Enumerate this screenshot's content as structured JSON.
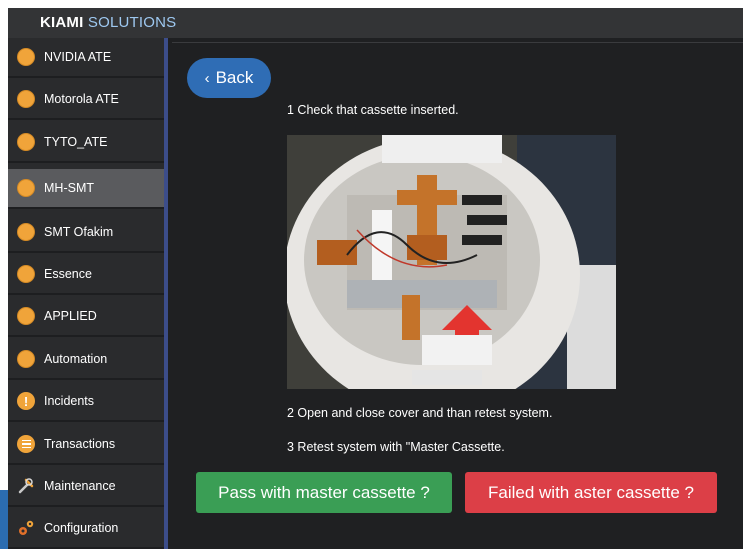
{
  "app": {
    "brand_bold": "KIAMI",
    "brand_light": "SOLUTIONS"
  },
  "sidebar": {
    "items": [
      {
        "label": "NVIDIA ATE",
        "icon": "circle-icon"
      },
      {
        "label": "Motorola ATE",
        "icon": "circle-icon"
      },
      {
        "label": "TYTO_ATE",
        "icon": "circle-icon"
      },
      {
        "label": "MH-SMT",
        "icon": "circle-icon",
        "active": true
      },
      {
        "label": "SMT Ofakim",
        "icon": "circle-icon"
      },
      {
        "label": "Essence",
        "icon": "circle-icon"
      },
      {
        "label": "APPLIED",
        "icon": "circle-icon"
      },
      {
        "label": "Automation",
        "icon": "circle-icon"
      },
      {
        "label": "Incidents",
        "icon": "warning-icon"
      },
      {
        "label": "Transactions",
        "icon": "list-icon"
      },
      {
        "label": "Maintenance",
        "icon": "wrench-icon"
      },
      {
        "label": "Configuration",
        "icon": "gears-icon"
      }
    ]
  },
  "main": {
    "back_label": "Back",
    "step1": "1 Check that cassette inserted.",
    "step2": "2 Open and close cover and than retest system.",
    "step3": "3 Retest system with \"Master Cassette.",
    "pass_button": "Pass with master cassette ?",
    "fail_button": "Failed with aster cassette ?"
  },
  "colors": {
    "accent": "#f0a43a",
    "back_button": "#2f6db5",
    "pass": "#3a9e55",
    "fail": "#dc3f47"
  }
}
